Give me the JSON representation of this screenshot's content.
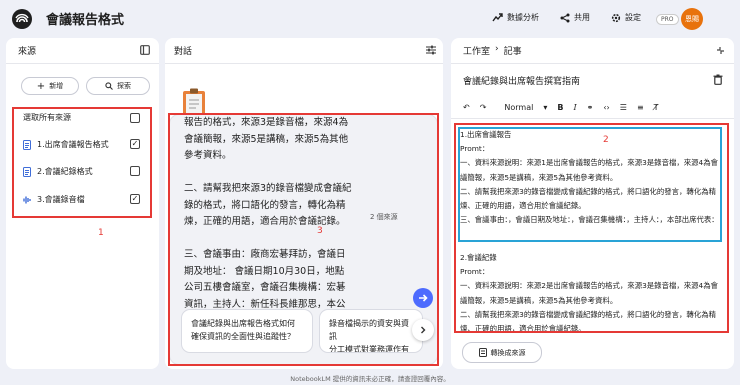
{
  "app": {
    "title": "會議報告格式",
    "header_buttons": [
      {
        "label": "數據分析",
        "icon": "analytics-icon"
      },
      {
        "label": "共用",
        "icon": "share-icon"
      },
      {
        "label": "設定",
        "icon": "gear-icon"
      }
    ],
    "pro_badge": "PRO",
    "avatar_text": "恩賜"
  },
  "sources": {
    "title": "來源",
    "add_label": "新增",
    "explore_label": "探索",
    "select_all_label": "選取所有來源",
    "items": [
      {
        "label": "1.出席會議報告格式",
        "icon": "document-icon",
        "checked": true
      },
      {
        "label": "2.會議紀錄格式",
        "icon": "document-icon",
        "checked": false
      },
      {
        "label": "3.會議錄音檔",
        "icon": "audio-icon",
        "checked": true
      }
    ],
    "annotation": "1"
  },
  "chat": {
    "title": "對話",
    "input_text": "報告的格式，來源3是錄音檔，來源4為會議簡報，來源5是講稿，來源5為其他參考資料。\n\n二、請幫我把來源3的錄音檔變成會議紀錄的格式，將口語化的發言，轉化為精煉，正確的用語，適合用於會議記錄。\n\n三、會議事由：廠商宏碁拜訪，會議日期及地址： 會議日期10月30日，地點公司五樓會議室，會議召集機構：宏碁資訊，主持人：新任科長維那思，本公司出席代表：張大雄",
    "source_count": "2 個來源",
    "annotation": "3",
    "suggestions": [
      "會議紀錄與出席報告格式如何\n確保資訊的全面性與追蹤性？",
      "錄音檔揭示的資安與資訊\n分工模式對業務運作有"
    ]
  },
  "studio": {
    "breadcrumb": [
      "工作室",
      "記事"
    ],
    "note_title": "會議紀錄與出席報告撰寫指南",
    "toolbar": {
      "style_label": "Normal"
    },
    "annotation": "2",
    "note_block_1": "1.出席會議報告\nPromt：\n一、資料來源說明：來源1是出席會議報告的格式，來源3是錄音檔，來源4為會議簡報，來源5是講稿，來源5為其他參考資料。\n二、請幫我把來源3的錄音檔變成會議紀錄的格式，將口語化的發言，轉化為精煉、正確的用語，適合用於會議紀錄。\n三、會議事由：，會議日期及地址：，會議召集機構：，主持人：，本部出席代表：",
    "note_block_2": "2.會議紀錄\nPromt：\n一、資料來源說明：來源2是出席會議報告的格式，來源3是錄音檔，來源4為會議簡報，來源5是講稿，來源5為其他參考資料。\n二、請幫我把來源3的錄音檔變成會議紀錄的格式，將口語化的發言，轉化為精煉、正確的用語，適合用於會議紀錄。",
    "convert_label": "轉換成來源"
  },
  "footer": "NotebookLM 提供的資訊未必正確，請查證回覆內容。",
  "colors": {
    "annotation_red": "#e53935",
    "annotation_blue": "#29a3d6",
    "avatar": "#e8720c",
    "send_button": "#4d6bfe"
  }
}
